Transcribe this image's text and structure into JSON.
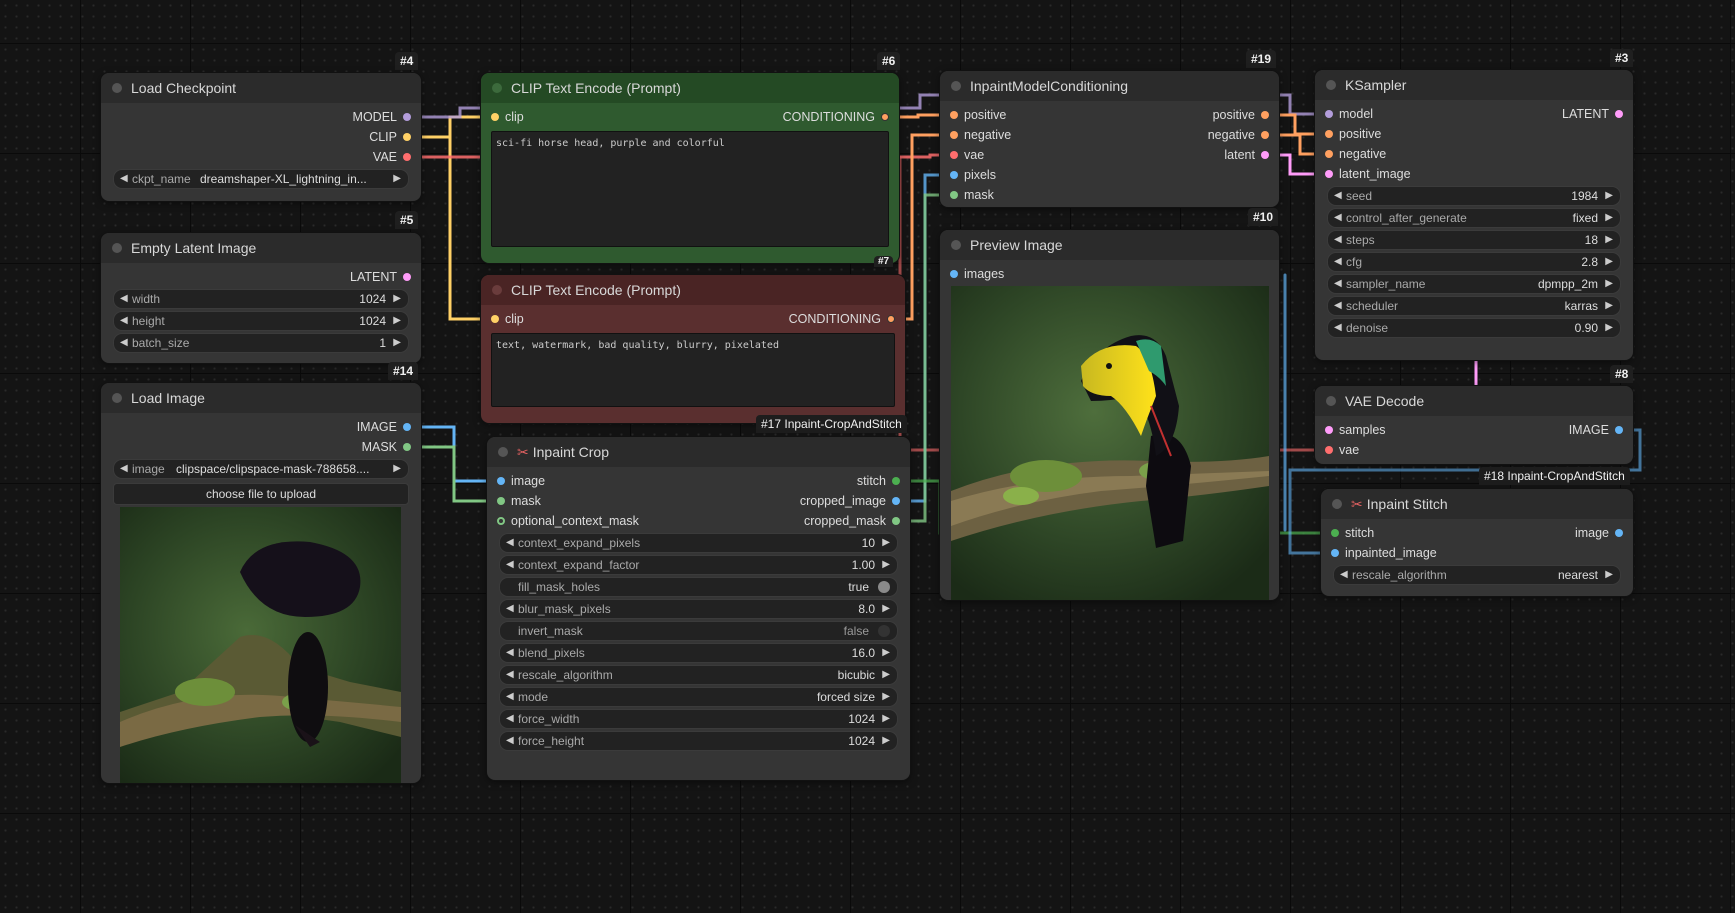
{
  "colors": {
    "model": "#b39ddb",
    "clip": "#ffd166",
    "vae": "#ff6e6e",
    "conditioning": "#ffa060",
    "latent": "#ff9cf9",
    "image": "#64b5f6",
    "mask": "#81c784",
    "stitch": "#4caf50"
  },
  "nodes": {
    "load_checkpoint": {
      "id": "#4",
      "title": "Load Checkpoint",
      "outputs": [
        "MODEL",
        "CLIP",
        "VAE"
      ],
      "ckpt_label": "ckpt_name",
      "ckpt_value": "dreamshaper-XL_lightning_in..."
    },
    "empty_latent": {
      "id": "#5",
      "title": "Empty Latent Image",
      "output": "LATENT",
      "widgets": [
        {
          "label": "width",
          "value": "1024"
        },
        {
          "label": "height",
          "value": "1024"
        },
        {
          "label": "batch_size",
          "value": "1"
        }
      ]
    },
    "load_image": {
      "id": "#14",
      "title": "Load Image",
      "outputs": [
        "IMAGE",
        "MASK"
      ],
      "image_label": "image",
      "image_value": "clipspace/clipspace-mask-788658....",
      "upload_label": "choose file to upload"
    },
    "clip_pos": {
      "id": "#6",
      "title": "CLIP Text Encode (Prompt)",
      "input": "clip",
      "output": "CONDITIONING",
      "text": "sci-fi horse head, purple and colorful"
    },
    "clip_neg": {
      "id": "#7",
      "title": "CLIP Text Encode (Prompt)",
      "input": "clip",
      "output": "CONDITIONING",
      "text": "text, watermark, bad quality, blurry, pixelated"
    },
    "inpaint_crop": {
      "id": "#17 Inpaint-CropAndStitch",
      "title": "Inpaint Crop",
      "inputs": [
        "image",
        "mask",
        "optional_context_mask"
      ],
      "outputs": [
        "stitch",
        "cropped_image",
        "cropped_mask"
      ],
      "widgets": [
        {
          "label": "context_expand_pixels",
          "value": "10"
        },
        {
          "label": "context_expand_factor",
          "value": "1.00"
        },
        {
          "label": "fill_mask_holes",
          "value": "true",
          "toggle": true
        },
        {
          "label": "blur_mask_pixels",
          "value": "8.0"
        },
        {
          "label": "invert_mask",
          "value": "false",
          "toggle": true
        },
        {
          "label": "blend_pixels",
          "value": "16.0"
        },
        {
          "label": "rescale_algorithm",
          "value": "bicubic"
        },
        {
          "label": "mode",
          "value": "forced size"
        },
        {
          "label": "force_width",
          "value": "1024"
        },
        {
          "label": "force_height",
          "value": "1024"
        }
      ]
    },
    "inpaint_cond": {
      "id": "#19",
      "title": "InpaintModelConditioning",
      "inputs": [
        "positive",
        "negative",
        "vae",
        "pixels",
        "mask"
      ],
      "outputs": [
        "positive",
        "negative",
        "latent"
      ]
    },
    "preview": {
      "id": "#10",
      "title": "Preview Image",
      "input": "images"
    },
    "ksampler": {
      "id": "#3",
      "title": "KSampler",
      "inputs": [
        "model",
        "positive",
        "negative",
        "latent_image"
      ],
      "output": "LATENT",
      "widgets": [
        {
          "label": "seed",
          "value": "1984"
        },
        {
          "label": "control_after_generate",
          "value": "fixed"
        },
        {
          "label": "steps",
          "value": "18"
        },
        {
          "label": "cfg",
          "value": "2.8"
        },
        {
          "label": "sampler_name",
          "value": "dpmpp_2m"
        },
        {
          "label": "scheduler",
          "value": "karras"
        },
        {
          "label": "denoise",
          "value": "0.90"
        }
      ]
    },
    "vae_decode": {
      "id": "#8",
      "title": "VAE Decode",
      "inputs": [
        "samples",
        "vae"
      ],
      "output": "IMAGE"
    },
    "inpaint_stitch": {
      "id": "#18 Inpaint-CropAndStitch",
      "title": "Inpaint Stitch",
      "inputs": [
        "stitch",
        "inpainted_image"
      ],
      "output": "image",
      "widget": {
        "label": "rescale_algorithm",
        "value": "nearest"
      }
    }
  }
}
